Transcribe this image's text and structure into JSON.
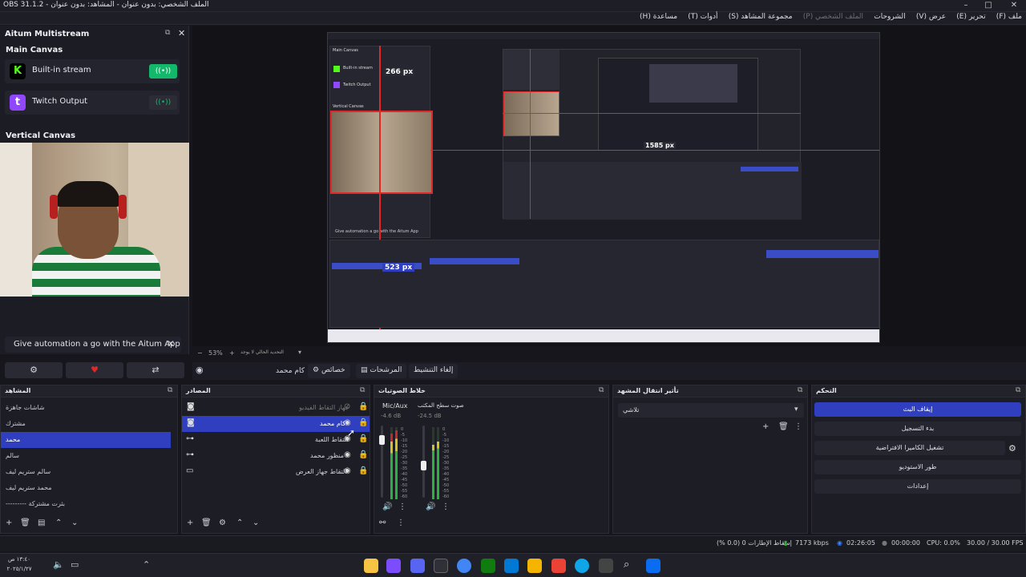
{
  "window": {
    "title": "OBS 31.1.2 - الملف الشخصي: بدون عنوان - المشاهد: بدون عنوان"
  },
  "menu": [
    {
      "label": "ملف (F)"
    },
    {
      "label": "تحرير (E)"
    },
    {
      "label": "عرض (V)"
    },
    {
      "label": "الشروحات"
    },
    {
      "label": "الملف الشخصي (P)",
      "disabled": true
    },
    {
      "label": "مجموعة المشاهد (S)"
    },
    {
      "label": "أدوات (T)"
    },
    {
      "label": "مساعدة (H)"
    }
  ],
  "aitum": {
    "title": "Aitum Multistream",
    "main_canvas": "Main Canvas",
    "outputs": [
      {
        "name": "Built-in stream",
        "logo": "K",
        "logo_color": "#53fc18",
        "active": true
      },
      {
        "name": "Twitch Output",
        "logo": "t",
        "logo_color": "#9146ff",
        "active": false
      }
    ],
    "vertical_canvas": "Vertical Canvas",
    "promo": "Give automation a go with the Aitum App",
    "toggle_icon": "((•))"
  },
  "preview": {
    "zoom": "53%",
    "zoom_note": "التحديد الحالي لا يوجد",
    "dim_labels": [
      "266 px",
      "523 px",
      "1585 px"
    ],
    "inner_labels": {
      "main_canvas": "Main Canvas",
      "built_in": "Built-in stream",
      "twitch": "Twitch Output",
      "vertical": "Vertical Canvas",
      "promo": "Give automation a go with the Aitum App"
    }
  },
  "context_bar": {
    "source_name": "كام محمد",
    "properties": "خصائص",
    "filters": "المرشحات",
    "deactivate": "إلغاء التنشيط"
  },
  "docks": {
    "scenes": {
      "title": "المشاهد",
      "items": [
        "شاشات جاهزة",
        "مشترك",
        "محمد",
        "سالم",
        "سالم ستريم ليف",
        "محمد ستريم ليف",
        "--------- بثرت مشتركة"
      ],
      "selected_index": 2
    },
    "sources": {
      "title": "المصادر",
      "items": [
        {
          "name": "جهاز التقاط الفيديو",
          "icon": "camera",
          "visible": false,
          "dimmed": true
        },
        {
          "name": "كام محمد",
          "icon": "camera",
          "visible": true,
          "selected": true
        },
        {
          "name": "التقاط اللعبة",
          "icon": "gamepad",
          "visible": true
        },
        {
          "name": "منظور محمد",
          "icon": "gamepad",
          "visible": true
        },
        {
          "name": "التقاط جهاز العرض",
          "icon": "monitor",
          "visible": true
        }
      ]
    },
    "mixer": {
      "title": "خلاط الصوتيات",
      "channels": [
        {
          "name": "Mic/Aux",
          "db": "-4.6 dB",
          "level": 0.78
        },
        {
          "name": "صوت سطح المكتب",
          "db": "-24.5 dB",
          "level": 0.62
        }
      ],
      "scale": [
        "0",
        "-5",
        "-10",
        "-15",
        "-20",
        "-25",
        "-30",
        "-35",
        "-40",
        "-45",
        "-50",
        "-55",
        "-60"
      ]
    },
    "transitions": {
      "title": "تأثير انتقال المشهد",
      "selected": "تلاشي"
    },
    "controls": {
      "title": "التحكم",
      "buttons": [
        "إيقاف البث",
        "بدء التسجيل",
        "تشغيل الكاميرا الافتراضية",
        "طور الاستوديو",
        "إعدادات"
      ],
      "active_index": 0
    }
  },
  "status": {
    "dropped": "إسقاط الإطارات 0 (0.0 %)",
    "bitrate": "7173 kbps",
    "stream_time": "02:26:05",
    "rec_time": "00:00:00",
    "cpu": "CPU: 0.0%",
    "fps": "30.00 / 30.00 FPS"
  },
  "taskbar": {
    "clock": "١٣:٤٠ ص",
    "date": "٢٠٢٥/١/٢٧"
  },
  "colors": {
    "accent": "#2f3fc0",
    "selection_red": "#e02828",
    "kick_green": "#53fc18",
    "twitch_purple": "#9146ff"
  }
}
